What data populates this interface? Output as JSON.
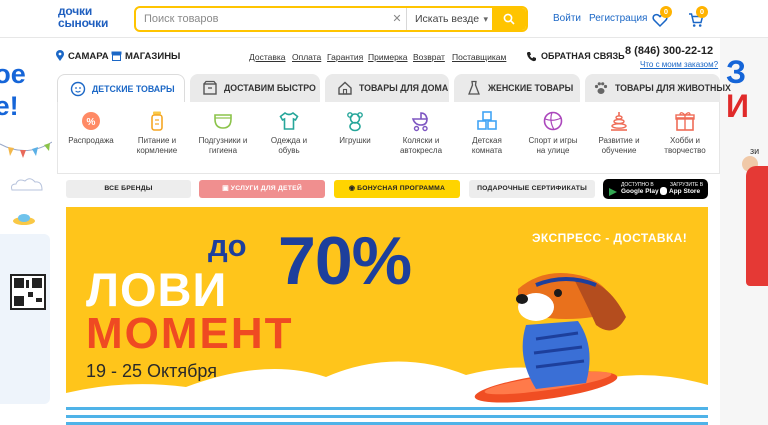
{
  "brand": {
    "logo_line1": "дочки",
    "logo_line2": "сыночки"
  },
  "search": {
    "placeholder": "Поиск товаров",
    "clear": "✕",
    "scope": "Искать везде"
  },
  "header": {
    "login": "Войти",
    "register": "Регистрация",
    "favorites_count": "0",
    "cart_count": "0"
  },
  "citybar": {
    "city": "САМАРА",
    "stores": "МАГАЗИНЫ",
    "links": [
      "Доставка",
      "Оплата",
      "Гарантия",
      "Примерка",
      "Возврат",
      "Поставщикам"
    ],
    "feedback": "ОБРАТНАЯ СВЯЗЬ",
    "phone": "8 (846) 300-22-12",
    "where_order": "Что с моим заказом?"
  },
  "tabs": [
    {
      "label": "ДЕТСКИЕ ТОВАРЫ"
    },
    {
      "label": "ДОСТАВИМ БЫСТРО"
    },
    {
      "label": "ТОВАРЫ ДЛЯ ДОМА"
    },
    {
      "label": "ЖЕНСКИЕ ТОВАРЫ"
    },
    {
      "label": "ТОВАРЫ ДЛЯ ЖИВОТНЫХ"
    }
  ],
  "categories": [
    {
      "l1": "Распродажа",
      "l2": ""
    },
    {
      "l1": "Питание и",
      "l2": "кормление"
    },
    {
      "l1": "Подгузники и",
      "l2": "гигиена"
    },
    {
      "l1": "Одежда и",
      "l2": "обувь"
    },
    {
      "l1": "Игрушки",
      "l2": ""
    },
    {
      "l1": "Коляски и",
      "l2": "автокресла"
    },
    {
      "l1": "Детская",
      "l2": "комната"
    },
    {
      "l1": "Спорт и игры",
      "l2": "на улице"
    },
    {
      "l1": "Развитие и",
      "l2": "обучение"
    },
    {
      "l1": "Хобби и",
      "l2": "творчество"
    }
  ],
  "pills": {
    "all_brands": "ВСЕ БРЕНДЫ",
    "kids_services": "УСЛУГИ ДЛЯ ДЕТЕЙ",
    "bonus": "БОНУСНАЯ ПРОГРАММА",
    "gift_cards": "ПОДАРОЧНЫЕ СЕРТИФИКАТЫ"
  },
  "stores_badge": {
    "gp_small": "ДОСТУПНО В",
    "gp_big": "Google Play",
    "as_small": "ЗАГРУЗИТЕ В",
    "as_big": "App Store"
  },
  "banner": {
    "do": "до",
    "percent": "70%",
    "line1": "ЛОВИ",
    "line2": "МОМЕНТ",
    "dates": "19 - 25 Октября",
    "express": "ЭКСПРЕСС - ДОСТАВКА!"
  },
  "side_ads": {
    "left_promo_1": "вое",
    "left_promo_2": "ие!",
    "right_big_1": "З",
    "right_big_2": "И",
    "right_sub": "зи"
  },
  "colors": {
    "accent_blue": "#1b67c6",
    "search_yellow": "#ffc400",
    "banner_yellow": "#ffc51b",
    "banner_orange": "#ef4a22",
    "banner_navy": "#1d3f9c"
  }
}
